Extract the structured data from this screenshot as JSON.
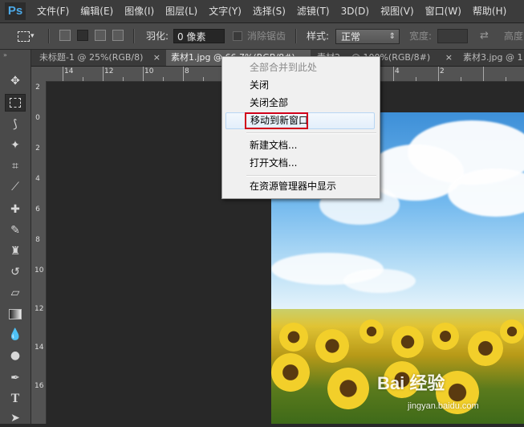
{
  "app": {
    "logo": "Ps"
  },
  "menu": [
    "文件(F)",
    "编辑(E)",
    "图像(I)",
    "图层(L)",
    "文字(Y)",
    "选择(S)",
    "滤镜(T)",
    "3D(D)",
    "视图(V)",
    "窗口(W)",
    "帮助(H)"
  ],
  "options": {
    "feather_label": "羽化:",
    "feather_value": "0 像素",
    "antialias_label": "消除锯齿",
    "style_label": "样式:",
    "style_value": "正常",
    "width_label": "宽度:",
    "height_label": "高度"
  },
  "tabs": [
    {
      "label": "未标题-1 @ 25%(RGB/8)",
      "active": false
    },
    {
      "label": "素材1.jpg @ 66.7%(RGB/8#)",
      "active": true
    },
    {
      "label": "素材2... @ 100%(RGB/8#)",
      "active": false
    },
    {
      "label": "素材3.jpg @ 1",
      "active": false
    }
  ],
  "ruler": {
    "h_labels": [
      "14",
      "12",
      "10",
      "8",
      "6",
      "4",
      "2"
    ],
    "v_labels": [
      "2",
      "0",
      "2",
      "4",
      "6",
      "8",
      "10",
      "12",
      "14",
      "16"
    ]
  },
  "context_menu": {
    "items": [
      {
        "label": "全部合并到此处",
        "state": "disabled"
      },
      {
        "label": "关闭",
        "state": "normal"
      },
      {
        "label": "关闭全部",
        "state": "normal"
      },
      {
        "label": "移动到新窗口",
        "state": "highlighted"
      },
      {
        "label": "新建文档...",
        "state": "normal"
      },
      {
        "label": "打开文档...",
        "state": "normal"
      },
      {
        "label": "在资源管理器中显示",
        "state": "normal"
      }
    ]
  },
  "watermark": {
    "brand": "Bai 经验",
    "url": "jingyan.baidu.com"
  },
  "colors": {
    "menubar_bg": "#3c3c3c",
    "panel_bg": "#4a4a4a",
    "canvas_bg": "#282828",
    "highlight_red": "#d0021b",
    "ps_blue": "#4ca9e8"
  },
  "tools": [
    "move-tool",
    "marquee-tool",
    "lasso-tool",
    "magic-wand-tool",
    "crop-tool",
    "eyedropper-tool",
    "healing-brush-tool",
    "brush-tool",
    "clone-stamp-tool",
    "history-brush-tool",
    "eraser-tool",
    "gradient-tool",
    "blur-tool",
    "dodge-tool",
    "pen-tool",
    "type-tool",
    "path-selection-tool"
  ]
}
